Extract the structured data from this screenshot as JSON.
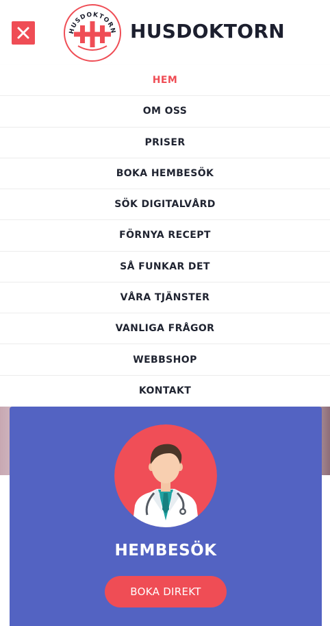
{
  "header": {
    "brand_name": "HUSDOKTORN",
    "logo_text": "HUSDOKTORN",
    "close_icon": "close-icon"
  },
  "menu": {
    "items": [
      {
        "label": "HEM",
        "active": true
      },
      {
        "label": "OM OSS"
      },
      {
        "label": "PRISER"
      },
      {
        "label": "BOKA HEMBESÖK"
      },
      {
        "label": "SÖK DIGITALVÅRD"
      },
      {
        "label": "FÖRNYA RECEPT"
      },
      {
        "label": "SÅ FUNKAR DET"
      },
      {
        "label": "VÅRA TJÄNSTER"
      },
      {
        "label": "VANLIGA FRÅGOR"
      },
      {
        "label": "WEBBSHOP"
      },
      {
        "label": "KONTAKT"
      }
    ]
  },
  "card": {
    "title": "HEMBESÖK",
    "button_label": "BOKA DIREKT",
    "icon": "doctor-avatar-icon"
  },
  "colors": {
    "accent": "#ef4d55",
    "card_bg": "#5363c2",
    "text_dark": "#1f2330",
    "white": "#ffffff"
  }
}
